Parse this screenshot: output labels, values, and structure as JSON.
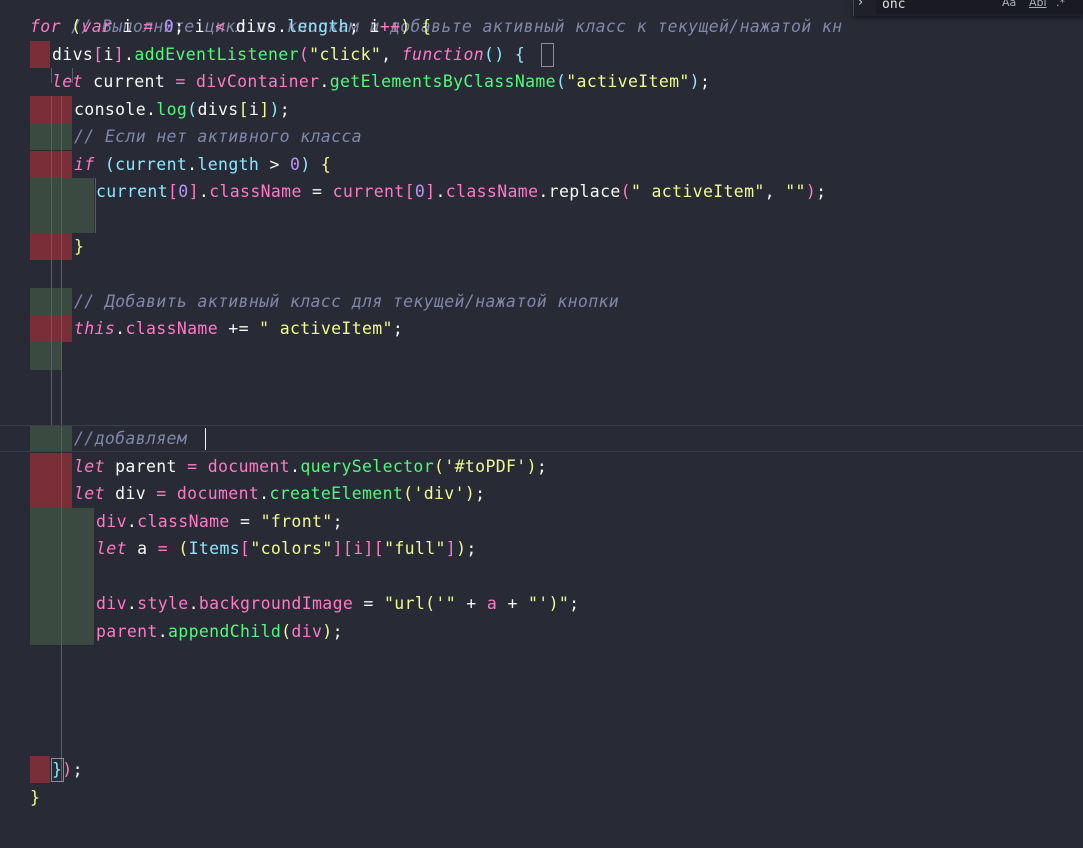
{
  "editor": {
    "line1": {
      "comment": "// Выполните цикл по кнопкам и добавьте активный класс к текущей/нажатой кн"
    },
    "line2": {
      "t1": "for",
      "t2": " ",
      "t3": "(",
      "t4": "var",
      "t5": " i ",
      "t6": "=",
      "t7": " ",
      "t8": "0",
      "t9": "; ",
      "t10": "i",
      "t11": " < ",
      "t12": "divs",
      "t13": ".",
      "t14": "length",
      "t15": "; ",
      "t16": "i",
      "t17": "++",
      "t18": ") ",
      "t19": "{"
    },
    "line3": {
      "t1": "divs",
      "t2": "[",
      "t3": "i",
      "t4": "]",
      "t5": ".",
      "t6": "addEventListener",
      "t7": "(",
      "t8": "\"click\"",
      "t9": ", ",
      "t10": "function",
      "t11": "(",
      "t12": ")",
      "t13": " ",
      "t14": "{"
    },
    "line4": {
      "t1": "let",
      "t2": " current ",
      "t3": "=",
      "t4": " ",
      "t5": "divContainer",
      "t6": ".",
      "t7": "getElementsByClassName",
      "t8": "(",
      "t9": "\"activeItem\"",
      "t10": ")",
      "t11": ";"
    },
    "line5": {
      "t1": "console",
      "t2": ".",
      "t3": "log",
      "t4": "(",
      "t5": "divs",
      "t6": "[",
      "t7": "i",
      "t8": "]",
      "t9": ")",
      "t10": ";"
    },
    "line6": {
      "comment": "// Если нет активного класса"
    },
    "line7": {
      "t1": "if",
      "t2": " ",
      "t3": "(",
      "t4": "current",
      "t5": ".",
      "t6": "length",
      "t7": " > ",
      "t8": "0",
      "t9": ")",
      "t10": " ",
      "t11": "{"
    },
    "line8": {
      "t1": "current",
      "t2": "[",
      "t3": "0",
      "t4": "]",
      "t5": ".",
      "t6": "className",
      "t7": " = ",
      "t8": "current",
      "t9": "[",
      "t10": "0",
      "t11": "]",
      "t12": ".",
      "t13": "className",
      "t14": ".",
      "t15": "replace",
      "t16": "(",
      "t17": "\" activeItem\"",
      "t18": ", ",
      "t19": "\"\"",
      "t20": ")",
      "t21": ";"
    },
    "line9": {
      "t1": "}"
    },
    "line10": {
      "comment": "// Добавить активный класс для текущей/нажатой кнопки"
    },
    "line11": {
      "t1": "this",
      "t2": ".",
      "t3": "className",
      "t4": " += ",
      "t5": "\" activeItem\"",
      "t6": ";"
    },
    "line12": {
      "comment": "//добавляем "
    },
    "line13": {
      "t1": "let",
      "t2": " parent ",
      "t3": "=",
      "t4": " ",
      "t5": "document",
      "t6": ".",
      "t7": "querySelector",
      "t8": "(",
      "t9": "'#toPDF'",
      "t10": ")",
      "t11": ";"
    },
    "line14": {
      "t1": "let",
      "t2": " div ",
      "t3": "=",
      "t4": " ",
      "t5": "document",
      "t6": ".",
      "t7": "createElement",
      "t8": "(",
      "t9": "'div'",
      "t10": ")",
      "t11": ";"
    },
    "line15": {
      "t1": "div",
      "t2": ".",
      "t3": "className",
      "t4": " = ",
      "t5": "\"front\"",
      "t6": ";"
    },
    "line16": {
      "t1": "let",
      "t2": " a ",
      "t3": "=",
      "t4": " ",
      "t5": "(",
      "t6": "Items",
      "t7": "[",
      "t8": "\"colors\"",
      "t9": "][",
      "t10": "i",
      "t11": "][",
      "t12": "\"full\"",
      "t13": "]",
      "t14": ")",
      "t15": ";"
    },
    "line17": {
      "t1": "div",
      "t2": ".",
      "t3": "style",
      "t4": ".",
      "t5": "backgroundImage",
      "t6": " = ",
      "t7": "\"url('\"",
      "t8": " + ",
      "t9": "a",
      "t10": " + ",
      "t11": "\"')\"",
      "t12": ";"
    },
    "line18": {
      "t1": "parent",
      "t2": ".",
      "t3": "appendChild",
      "t4": "(",
      "t5": "div",
      "t6": ")",
      "t7": ";"
    },
    "line19": {
      "t1": "}",
      "t2": ")",
      "t3": ";"
    },
    "line20": {
      "t1": "}"
    }
  },
  "find_widget": {
    "query": "onc",
    "arrow": "›",
    "match_case": "Aa",
    "whole_word": "Abl",
    "regex": ".*"
  },
  "colors": {
    "background": "#282a36",
    "keyword": "#ff79c6",
    "function": "#50fa7b",
    "property": "#8be9fd",
    "string": "#f1fa8c",
    "number": "#bd93f9",
    "comment": "#7f88a8",
    "indent_error": "#7a2f38",
    "indent_ok": "#3a4a40"
  }
}
